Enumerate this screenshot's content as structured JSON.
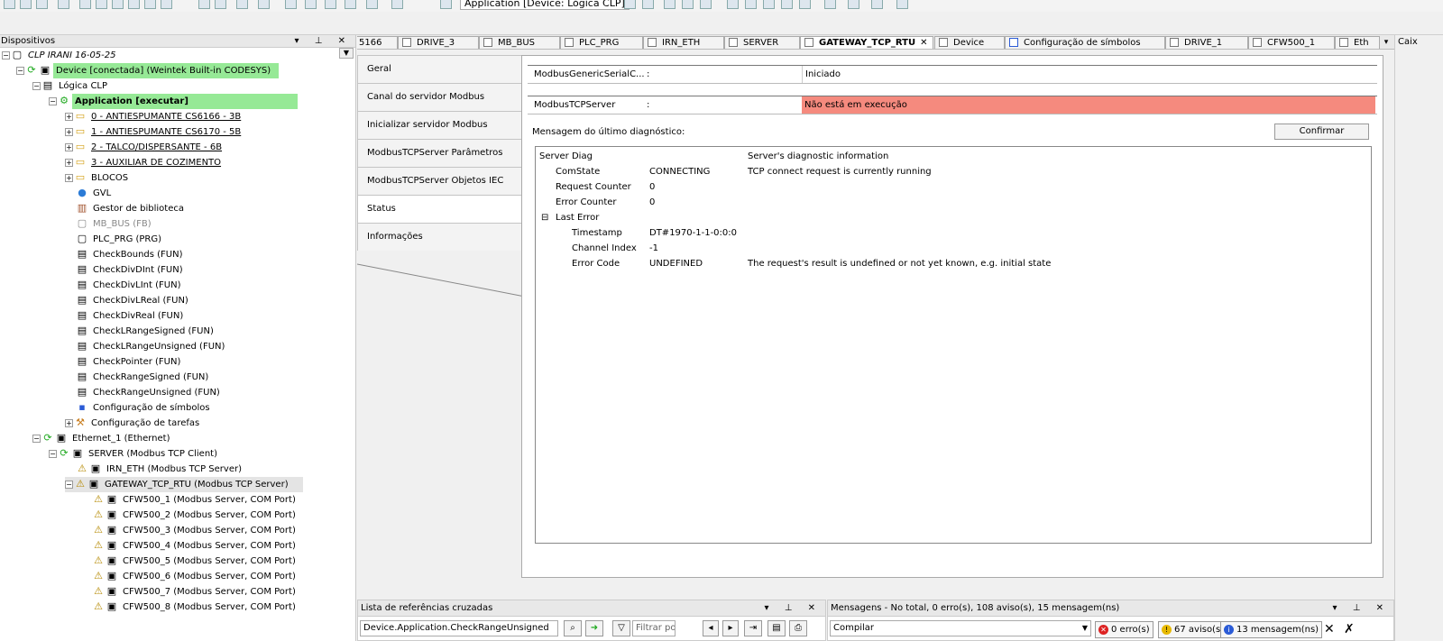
{
  "toolbar": {
    "application_combo": "Application [Device: Lógica CLP]"
  },
  "devices_panel": {
    "title": "Dispositivos",
    "controls": "▾ ⊥ ✕",
    "tree": [
      {
        "label": "CLP IRANI 16-05-25",
        "italic": true
      },
      {
        "label": "Device [conectada] (Weintek Built-in CODESYS)"
      },
      {
        "label": "Lógica CLP"
      },
      {
        "label": "Application [executar]"
      },
      {
        "label": "0 - ANTIESPUMANTE CS6166 - 3B"
      },
      {
        "label": "1 - ANTIESPUMANTE CS6170 - 5B"
      },
      {
        "label": "2 - TALCO/DISPERSANTE - 6B"
      },
      {
        "label": "3 - AUXILIAR DE COZIMENTO"
      },
      {
        "label": "BLOCOS"
      },
      {
        "label": "GVL"
      },
      {
        "label": "Gestor de biblioteca"
      },
      {
        "label": "MB_BUS (FB)"
      },
      {
        "label": "PLC_PRG (PRG)"
      },
      {
        "label": "CheckBounds (FUN)"
      },
      {
        "label": "CheckDivDInt (FUN)"
      },
      {
        "label": "CheckDivLInt (FUN)"
      },
      {
        "label": "CheckDivLReal (FUN)"
      },
      {
        "label": "CheckDivReal (FUN)"
      },
      {
        "label": "CheckLRangeSigned (FUN)"
      },
      {
        "label": "CheckLRangeUnsigned (FUN)"
      },
      {
        "label": "CheckPointer (FUN)"
      },
      {
        "label": "CheckRangeSigned (FUN)"
      },
      {
        "label": "CheckRangeUnsigned (FUN)"
      },
      {
        "label": "Configuração de símbolos"
      },
      {
        "label": "Configuração de tarefas"
      },
      {
        "label": "Ethernet_1 (Ethernet)"
      },
      {
        "label": "SERVER (Modbus TCP Client)"
      },
      {
        "label": "IRN_ETH (Modbus TCP Server)"
      },
      {
        "label": "GATEWAY_TCP_RTU (Modbus TCP Server)"
      },
      {
        "label": "CFW500_1 (Modbus Server, COM Port)"
      },
      {
        "label": "CFW500_2 (Modbus Server, COM Port)"
      },
      {
        "label": "CFW500_3 (Modbus Server, COM Port)"
      },
      {
        "label": "CFW500_4 (Modbus Server, COM Port)"
      },
      {
        "label": "CFW500_5 (Modbus Server, COM Port)"
      },
      {
        "label": "CFW500_6 (Modbus Server, COM Port)"
      },
      {
        "label": "CFW500_7 (Modbus Server, COM Port)"
      },
      {
        "label": "CFW500_8 (Modbus Server, COM Port)"
      }
    ]
  },
  "doc_tabs": [
    {
      "label": "5166"
    },
    {
      "label": "DRIVE_3"
    },
    {
      "label": "MB_BUS"
    },
    {
      "label": "PLC_PRG"
    },
    {
      "label": "IRN_ETH"
    },
    {
      "label": "SERVER"
    },
    {
      "label": "GATEWAY_TCP_RTU",
      "active": true
    },
    {
      "label": "Device"
    },
    {
      "label": "Configuração de símbolos"
    },
    {
      "label": "DRIVE_1"
    },
    {
      "label": "CFW500_1"
    },
    {
      "label": "Eth"
    }
  ],
  "right_strip_label": "Caix",
  "editor": {
    "side_tabs": [
      {
        "label": "Geral"
      },
      {
        "label": "Canal do servidor Modbus"
      },
      {
        "label": "Inicializar servidor Modbus"
      },
      {
        "label": "ModbusTCPServer Parâmetros"
      },
      {
        "label": "ModbusTCPServer Objetos IEC"
      },
      {
        "label": "Status",
        "active": true
      },
      {
        "label": "Informações"
      }
    ],
    "generic_serial": {
      "name": "ModbusGenericSerialC...",
      "sep": ":",
      "status": "Iniciado"
    },
    "tcp_server": {
      "name": "ModbusTCPServer",
      "sep": ":",
      "status": "Não está em execução",
      "status_color": "#f58a7e"
    },
    "last_diag_label": "Mensagem do último diagnóstico:",
    "confirm_button": "Confirmar",
    "diag": {
      "header": {
        "name": "Server Diag",
        "info": "Server's diagnostic information"
      },
      "rows": [
        {
          "name": "ComState",
          "value": "CONNECTING",
          "info": "TCP connect request is currently running"
        },
        {
          "name": "Request Counter",
          "value": "0",
          "info": ""
        },
        {
          "name": "Error Counter",
          "value": "0",
          "info": ""
        },
        {
          "name": "Last Error",
          "value": "",
          "info": ""
        },
        {
          "name": "Timestamp",
          "value": "DT#1970-1-1-0:0:0",
          "info": ""
        },
        {
          "name": "Channel Index",
          "value": "-1",
          "info": ""
        },
        {
          "name": "Error Code",
          "value": "UNDEFINED",
          "info": "The request's result is undefined or not yet known, e.g. initial state"
        }
      ]
    }
  },
  "xref_panel": {
    "title": "Lista de referências cruzadas",
    "controls": "▾ ⊥ ✕",
    "input_value": "Device.Application.CheckRangeUnsigned",
    "filter_placeholder": "Filtrar por"
  },
  "messages_panel": {
    "title": "Mensagens - No total, 0 erro(s), 108 aviso(s), 15 mensagem(ns)",
    "controls": "▾ ⊥ ✕",
    "category": "Compilar",
    "errors": "0 erro(s)",
    "warnings": "67 aviso(s)",
    "messages": "13 mensagem(ns)"
  }
}
